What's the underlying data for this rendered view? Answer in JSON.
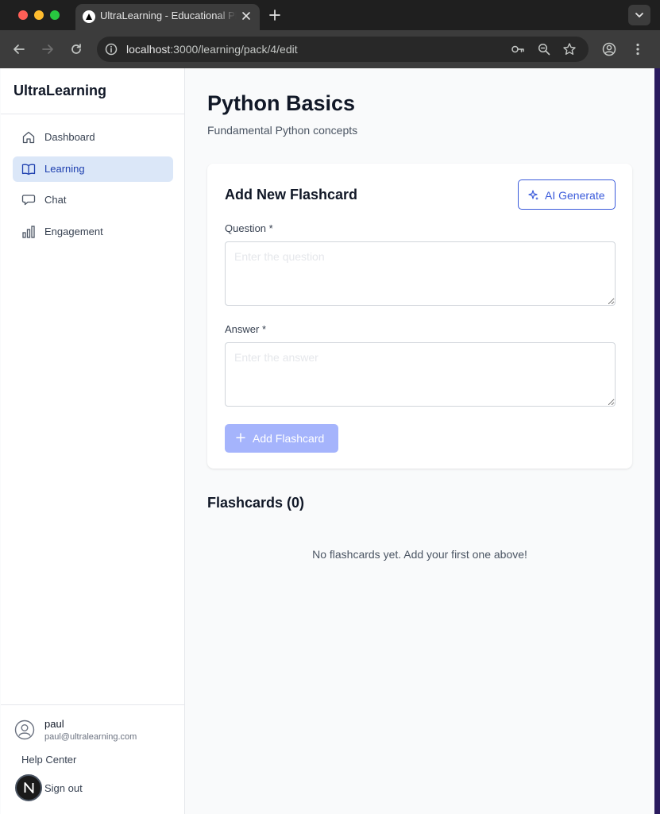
{
  "browser": {
    "tab_title": "UltraLearning - Educational Platform",
    "url_host": "localhost",
    "url_path": ":3000/learning/pack/4/edit"
  },
  "sidebar": {
    "brand": "UltraLearning",
    "items": [
      {
        "label": "Dashboard",
        "icon": "home-icon",
        "active": false
      },
      {
        "label": "Learning",
        "icon": "book-open-icon",
        "active": true
      },
      {
        "label": "Chat",
        "icon": "chat-icon",
        "active": false
      },
      {
        "label": "Engagement",
        "icon": "bar-chart-icon",
        "active": false
      }
    ],
    "user": {
      "name": "paul",
      "email": "paul@ultralearning.com"
    },
    "help_label": "Help Center",
    "signout_label": "Sign out",
    "badge_letter": "N"
  },
  "main": {
    "title": "Python Basics",
    "subtitle": "Fundamental Python concepts",
    "form": {
      "title": "Add New Flashcard",
      "ai_button": "AI Generate",
      "question_label": "Question *",
      "question_placeholder": "Enter the question",
      "question_value": "",
      "answer_label": "Answer *",
      "answer_placeholder": "Enter the answer",
      "answer_value": "",
      "submit_label": "Add Flashcard"
    },
    "list": {
      "title": "Flashcards (0)",
      "empty_message": "No flashcards yet. Add your first one above!"
    }
  },
  "colors": {
    "accent": "#3b5bdb",
    "active_nav_bg": "#dbe7f8",
    "disabled_button": "#a5b4fc"
  }
}
